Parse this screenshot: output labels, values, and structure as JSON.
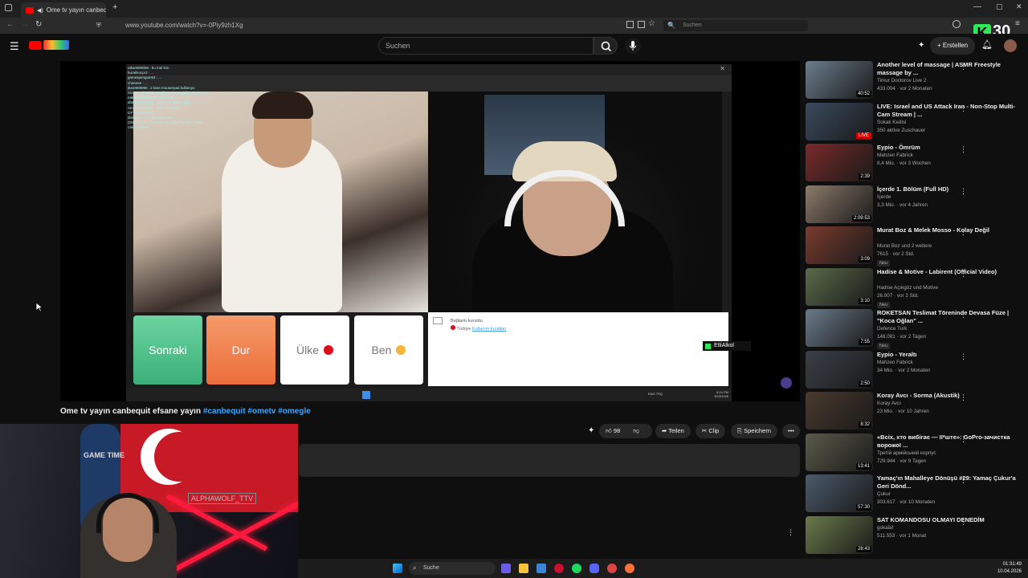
{
  "browser": {
    "tab_title": "Ome tv yayın canbequit efs",
    "url": "www.youtube.com/watch?v=-0Piy9zh1Xg",
    "search_placeholder": "Suchen"
  },
  "masthead": {
    "search_placeholder": "Suchen",
    "create_label": "Erstellen",
    "overlay_counter": "30",
    "overlay_letter": "K"
  },
  "player": {
    "ome": {
      "chat_lines": [
        "utkan909090 : bu mal kim",
        "burakkocpr2 : ...",
        "gamespenguin54 : ...",
        "cheeeee : ...",
        "ikam909090 : 2 tane mouserpad kullanıyo",
        "nsc...? : şimdiye cocuklaşın neye gidiyorsun yazıy",
        "nakubunusaler53 : yapın yok",
        "ahachatxxxxx99 : yayın yok diyen aptal",
        "AmenMcGregor : CAN CHAPLIN",
        "OTTMOKROZIZ :",
        "drelopee : bi yada görek ya",
        "ONTER_v01 : kok sen yazdığın bakabilir misin",
        "cake sahnesi"
      ],
      "btn_next": "Sonraki",
      "btn_stop": "Dur",
      "btn_country": "Ülke",
      "btn_me": "Ben",
      "chat_connected": "Bağlantı kuruldu.",
      "chat_country": "Türkiye",
      "chat_rules": "Kullanım kuralları",
      "tray_lang": "ENG TRQ",
      "tray_time": "6:24 PM",
      "tray_date": "3/23/2026"
    },
    "hover_user": "EtliAlkol"
  },
  "video": {
    "title": "Ome tv yayın canbequit efsane yayın ",
    "tags": "#canbequit #ometv #omegle",
    "likes": "98",
    "share_label": "Teilen",
    "clip_label": "Clip",
    "save_label": "Speichern"
  },
  "facecam": {
    "logo_text": "GAME TIME",
    "alpha_text": "ALPHAWOLF_TTV"
  },
  "recommendations": [
    {
      "title": "Another level of massage | ASMR Freestyle massage by ...",
      "channel": "Timur Doctorov Live 2",
      "meta": "433.004 · vor 2 Monaten",
      "duration": "40:52"
    },
    {
      "title": "LIVE: Israel and US Attack Iran - Non-Stop Multi-Cam Stream | ...",
      "channel": "Sokak Kedisi",
      "meta": "350 aktive Zuschauer",
      "live": "LIVE"
    },
    {
      "title": "Eypio - Ömrüm",
      "channel": "Mahzen Fabrick",
      "meta": "8,4 Mio. · vor 3 Wochen",
      "duration": "2:39"
    },
    {
      "title": "İçerde 1. Bölüm (Full HD)",
      "channel": "İçerde",
      "meta": "3,3 Mio. · vor 4 Jahren",
      "duration": "2:09:53"
    },
    {
      "title": "Murat Boz & Melek Mosso - Kolay Değil",
      "channel": "Murat Boz und 2 weitere",
      "meta": "7615 · vor 2 Std.",
      "badge": "Neu",
      "duration": "3:09"
    },
    {
      "title": "Hadise & Motive - Labirent (Official Video)",
      "channel": "Hadise Açıkgöz und Motive",
      "meta": "26.007 · vor 2 Std.",
      "badge": "Neu",
      "duration": "3:10"
    },
    {
      "title": "ROKETSAN Teslimat Töreninde Devasa Füze | \"Koca Oğlan\" ...",
      "channel": "Defence Turk",
      "meta": "148.081 · vor 2 Tagen",
      "badge": "Neu",
      "duration": "7:55"
    },
    {
      "title": "Eypio - Yeraltı",
      "channel": "Mahzen Fabrick",
      "meta": "34 Mio. · vor 2 Monaten",
      "duration": "2:50"
    },
    {
      "title": "Koray Avcı - Sorma (Akustik)",
      "channel": "Koray Avcı",
      "meta": "23 Mio. · vor 10 Jahren",
      "duration": "8:32"
    },
    {
      "title": "«Всіх, хто вибігає — її*ште»: GoPro-зачистка ворожої ...",
      "channel": "Третій армійський корпус",
      "meta": "729.944 · vor 9 Tagen",
      "duration": "13:41"
    },
    {
      "title": "Yamaç'ın Mahalleye Dönüşü #29: Yamaç Çukur'a Geri Dönd...",
      "channel": "Çukur",
      "meta": "303.617 · vor 10 Monaten",
      "duration": "57:30"
    },
    {
      "title": "SAT KOMANDOSU OLMAYI DENEDİM",
      "channel": "gokalaf",
      "meta": "511.553 · vor 1 Monat",
      "duration": "28:43"
    }
  ],
  "taskbar": {
    "search_label": "Suche",
    "time": "01:31:49",
    "date": "10.04.2026"
  },
  "colors": {
    "yt_red": "#ff0000",
    "link_blue": "#3ea6ff",
    "ome_green": "#3bb07a",
    "ome_orange": "#ec6e3c"
  }
}
